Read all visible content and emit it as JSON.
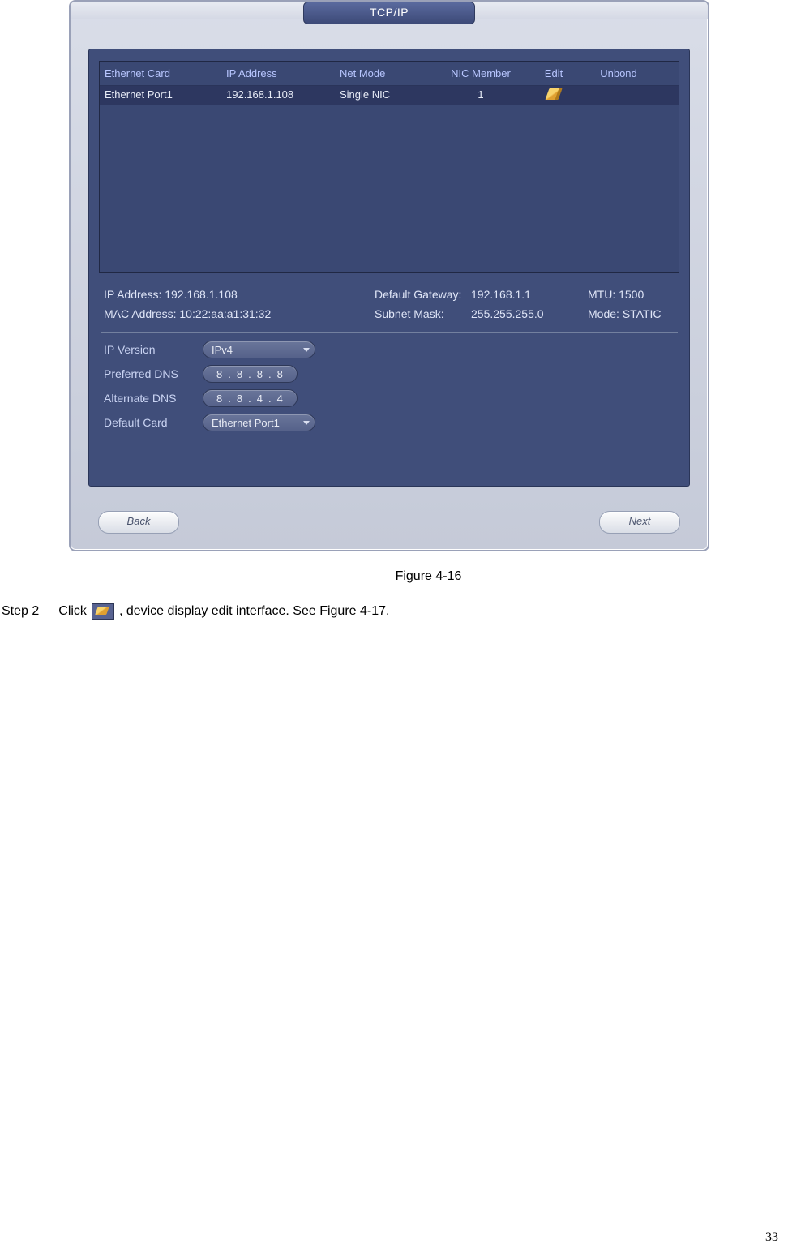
{
  "dialog": {
    "title": "TCP/IP",
    "table": {
      "headers": {
        "ethernet_card": "Ethernet Card",
        "ip_address": "IP Address",
        "net_mode": "Net Mode",
        "nic_member": "NIC Member",
        "edit": "Edit",
        "unbond": "Unbond"
      },
      "rows": [
        {
          "ethernet_card": "Ethernet Port1",
          "ip_address": "192.168.1.108",
          "net_mode": "Single NIC",
          "nic_member": "1"
        }
      ]
    },
    "details": {
      "ip_address_label": "IP Address:",
      "ip_address_value": "192.168.1.108",
      "mac_address_label": "MAC Address:",
      "mac_address_value": "10:22:aa:a1:31:32",
      "default_gateway_label": "Default Gateway:",
      "default_gateway_value": "192.168.1.1",
      "subnet_mask_label": "Subnet Mask:",
      "subnet_mask_value": "255.255.255.0",
      "mtu_label": "MTU:",
      "mtu_value": "1500",
      "mode_label": "Mode:",
      "mode_value": "STATIC"
    },
    "form": {
      "ip_version_label": "IP Version",
      "ip_version_value": "IPv4",
      "preferred_dns_label": "Preferred DNS",
      "preferred_dns_octets": [
        "8",
        "8",
        "8",
        "8"
      ],
      "alternate_dns_label": "Alternate DNS",
      "alternate_dns_octets": [
        "8",
        "8",
        "4",
        "4"
      ],
      "default_card_label": "Default Card",
      "default_card_value": "Ethernet Port1"
    },
    "buttons": {
      "back": "Back",
      "next": "Next"
    }
  },
  "caption": "Figure 4-16",
  "step": {
    "label": "Step 2",
    "text_before": "Click",
    "text_after": ", device display edit interface. See Figure 4-17."
  },
  "page_number": "33"
}
